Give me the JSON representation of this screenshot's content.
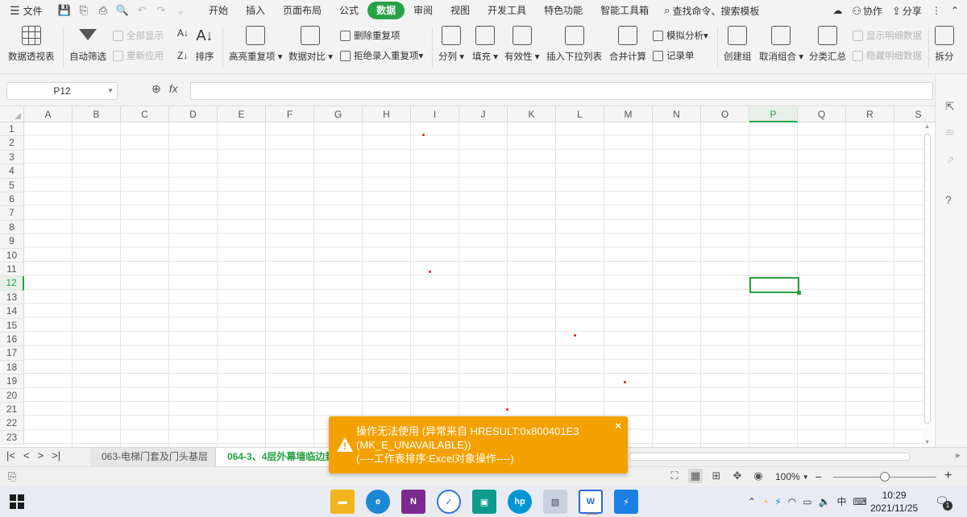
{
  "menu": {
    "file_label": "文件",
    "tabs": [
      {
        "label": "开始"
      },
      {
        "label": "插入"
      },
      {
        "label": "页面布局"
      },
      {
        "label": "公式"
      },
      {
        "label": "数据",
        "active": true
      },
      {
        "label": "审阅"
      },
      {
        "label": "视图"
      },
      {
        "label": "开发工具"
      },
      {
        "label": "特色功能"
      },
      {
        "label": "智能工具箱"
      }
    ],
    "search_label": "查找命令、搜索模板",
    "collab_label": "协作",
    "share_label": "分享"
  },
  "ribbon": {
    "pivot": "数据透视表",
    "autofilter": "自动筛选",
    "show_all": "全部显示",
    "reapply": "重新应用",
    "sort": "排序",
    "highlight_dup": "高亮重复项",
    "compare": "数据对比",
    "delete_dup": "删除重复项",
    "reject_dup": "拒绝录入重复项",
    "split": "分列",
    "fill": "填充",
    "validity": "有效性",
    "insert_dropdown": "插入下拉列表",
    "consolidate": "合并计算",
    "whatif": "模拟分析",
    "record": "记录单",
    "group": "创建组",
    "ungroup": "取消组合",
    "subtotal": "分类汇总",
    "show_detail": "显示明细数据",
    "hide_detail": "隐藏明细数据",
    "split_table": "拆分"
  },
  "formula_bar": {
    "cell_ref": "P12",
    "fx": "fx",
    "formula": ""
  },
  "grid": {
    "columns": [
      "A",
      "B",
      "C",
      "D",
      "E",
      "F",
      "G",
      "H",
      "I",
      "J",
      "K",
      "L",
      "M",
      "N",
      "O",
      "P",
      "Q",
      "R",
      "S"
    ],
    "rows": [
      "1",
      "2",
      "3",
      "4",
      "5",
      "6",
      "7",
      "8",
      "9",
      "10",
      "11",
      "12",
      "13",
      "14",
      "15",
      "16",
      "17",
      "18",
      "19",
      "20",
      "21",
      "22",
      "23"
    ],
    "selected_column": "P",
    "selected_row": "12"
  },
  "sheets": {
    "tabs": [
      {
        "label": "063-电梯门套及门头基层",
        "active": false
      },
      {
        "label": "064-3、4层外幕墙临边封",
        "active": true
      }
    ]
  },
  "status": {
    "zoom": "100%"
  },
  "toast": {
    "line1": "操作无法使用 (异常来自 HRESULT:0x800401E3",
    "line2": "(MK_E_UNAVAILABLE))",
    "line3": "(----工作表排序:Excel对象操作----)",
    "close": "×",
    "color": "#f3a100"
  },
  "taskbar": {
    "time": "10:29",
    "date": "2021/11/25",
    "ime": "中",
    "notifications": "1"
  },
  "colors": {
    "accent": "#27a244",
    "error_dot": "#e02020"
  }
}
